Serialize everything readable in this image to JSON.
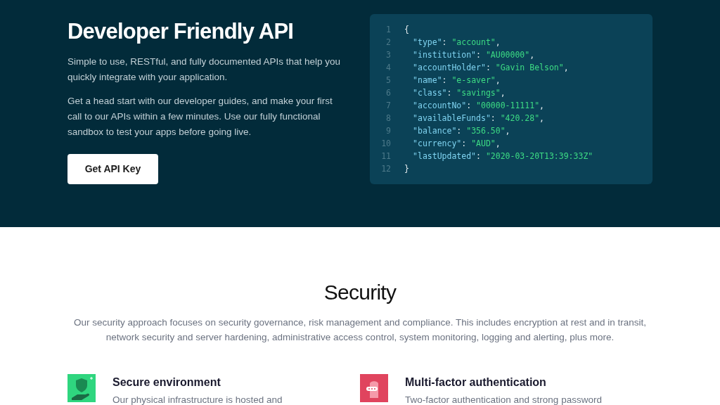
{
  "hero": {
    "title": "Developer Friendly API",
    "paragraphs": [
      "Simple to use, RESTful, and fully documented APIs that help you quickly integrate with your application.",
      "Get a head start with our developer guides, and make your first call to our APIs within a few minutes. Use our fully functional sandbox to test your apps before going live."
    ],
    "button": "Get API Key"
  },
  "code": {
    "lines": [
      {
        "number": "1",
        "parts": [
          {
            "kind": "punct",
            "text": "{"
          }
        ]
      },
      {
        "number": "2",
        "parts": [
          {
            "kind": "key",
            "text": "\"type\""
          },
          {
            "kind": "punct",
            "text": ": "
          },
          {
            "kind": "string",
            "text": "\"account\""
          },
          {
            "kind": "punct",
            "text": ","
          }
        ]
      },
      {
        "number": "3",
        "parts": [
          {
            "kind": "key",
            "text": "\"institution\""
          },
          {
            "kind": "punct",
            "text": ": "
          },
          {
            "kind": "string",
            "text": "\"AU00000\""
          },
          {
            "kind": "punct",
            "text": ","
          }
        ]
      },
      {
        "number": "4",
        "parts": [
          {
            "kind": "key",
            "text": "\"accountHolder\""
          },
          {
            "kind": "punct",
            "text": ": "
          },
          {
            "kind": "string",
            "text": "\"Gavin Belson\""
          },
          {
            "kind": "punct",
            "text": ","
          }
        ]
      },
      {
        "number": "5",
        "parts": [
          {
            "kind": "key",
            "text": "\"name\""
          },
          {
            "kind": "punct",
            "text": ": "
          },
          {
            "kind": "string",
            "text": "\"e-saver\""
          },
          {
            "kind": "punct",
            "text": ","
          }
        ]
      },
      {
        "number": "6",
        "parts": [
          {
            "kind": "key",
            "text": "\"class\""
          },
          {
            "kind": "punct",
            "text": ": "
          },
          {
            "kind": "string",
            "text": "\"savings\""
          },
          {
            "kind": "punct",
            "text": ","
          }
        ]
      },
      {
        "number": "7",
        "parts": [
          {
            "kind": "key",
            "text": "\"accountNo\""
          },
          {
            "kind": "punct",
            "text": ": "
          },
          {
            "kind": "string",
            "text": "\"00000-11111\""
          },
          {
            "kind": "punct",
            "text": ","
          }
        ]
      },
      {
        "number": "8",
        "parts": [
          {
            "kind": "key",
            "text": "\"availableFunds\""
          },
          {
            "kind": "punct",
            "text": ": "
          },
          {
            "kind": "string",
            "text": "\"420.28\""
          },
          {
            "kind": "punct",
            "text": ","
          }
        ]
      },
      {
        "number": "9",
        "parts": [
          {
            "kind": "key",
            "text": "\"balance\""
          },
          {
            "kind": "punct",
            "text": ": "
          },
          {
            "kind": "string",
            "text": "\"356.50\""
          },
          {
            "kind": "punct",
            "text": ","
          }
        ]
      },
      {
        "number": "10",
        "parts": [
          {
            "kind": "key",
            "text": "\"currency\""
          },
          {
            "kind": "punct",
            "text": ": "
          },
          {
            "kind": "string",
            "text": "\"AUD\""
          },
          {
            "kind": "punct",
            "text": ","
          }
        ]
      },
      {
        "number": "11",
        "parts": [
          {
            "kind": "key",
            "text": "\"lastUpdated\""
          },
          {
            "kind": "punct",
            "text": ": "
          },
          {
            "kind": "string",
            "text": "\"2020-03-20T13:39:33Z\""
          }
        ]
      },
      {
        "number": "12",
        "parts": [
          {
            "kind": "punct",
            "text": "}"
          }
        ]
      }
    ]
  },
  "security": {
    "title": "Security",
    "description": "Our security approach focuses on security governance, risk management and compliance. This includes encryption at rest and in transit, network security and server hardening, administrative access control, system monitoring, logging and alerting, plus more.",
    "features": [
      {
        "kind": "shield",
        "title": "Secure environment",
        "text": "Our physical infrastructure is hosted and"
      },
      {
        "kind": "lock",
        "title": "Multi-factor authentication",
        "text": "Two-factor authentication and strong password"
      }
    ]
  }
}
